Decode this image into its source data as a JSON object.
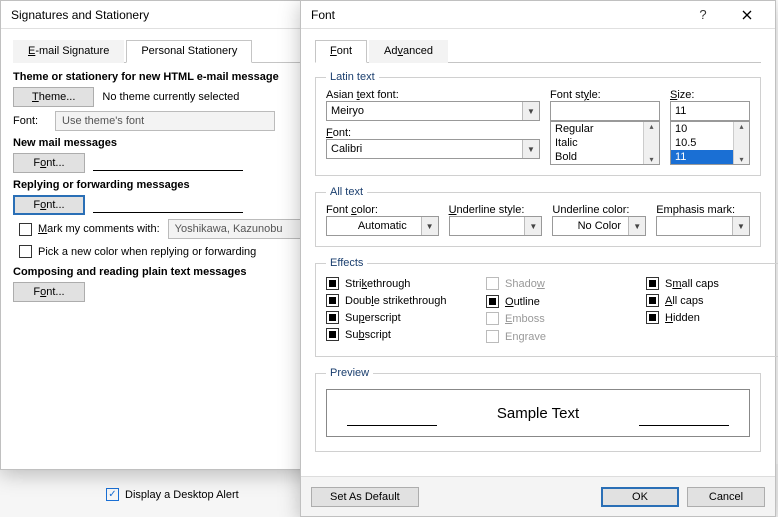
{
  "bgItems": {
    "partial_checkbox_text": "...",
    "desktop_alert": "Display a Desktop Alert"
  },
  "sigwin": {
    "title": "Signatures and Stationery",
    "tabs": {
      "email": "E-mail Signature",
      "personal": "Personal Stationery"
    },
    "theme_heading": "Theme or stationery for new HTML e-mail message",
    "theme_btn": "Theme...",
    "no_theme": "No theme currently selected",
    "font_label": "Font:",
    "font_value": "Use theme's font",
    "new_mail": "New mail messages",
    "font_btn": "Font...",
    "reply_fwd": "Replying or forwarding messages",
    "mark_comments": "Mark my comments with:",
    "mark_value": "Yoshikawa, Kazunobu",
    "pick_color": "Pick a new color when replying or forwarding",
    "plain_text": "Composing and reading plain text messages"
  },
  "fontwin": {
    "title": "Font",
    "tabs": {
      "font": "Font",
      "advanced": "Advanced"
    },
    "latin_legend": "Latin text",
    "asian_font_lbl": "Asian text font:",
    "asian_font_val": "Meiryo",
    "font_lbl": "Font:",
    "font_val": "Calibri",
    "style_lbl": "Font style:",
    "style_val": "",
    "styles": [
      "Regular",
      "Italic",
      "Bold"
    ],
    "size_lbl": "Size:",
    "size_val": "11",
    "sizes": [
      "10",
      "10.5",
      "11"
    ],
    "alltext_legend": "All text",
    "font_color_lbl": "Font color:",
    "font_color_val": "Automatic",
    "underline_style_lbl": "Underline style:",
    "underline_style_val": "",
    "underline_color_lbl": "Underline color:",
    "underline_color_val": "No Color",
    "emphasis_lbl": "Emphasis mark:",
    "emphasis_val": "",
    "effects_legend": "Effects",
    "effects": {
      "strike": "Strikethrough",
      "dstrike": "Double strikethrough",
      "super": "Superscript",
      "sub": "Subscript",
      "shadow": "Shadow",
      "outline": "Outline",
      "emboss": "Emboss",
      "engrave": "Engrave",
      "smallcaps": "Small caps",
      "allcaps": "All caps",
      "hidden": "Hidden"
    },
    "preview_legend": "Preview",
    "preview_text": "Sample Text",
    "set_default": "Set As Default",
    "ok": "OK",
    "cancel": "Cancel"
  }
}
